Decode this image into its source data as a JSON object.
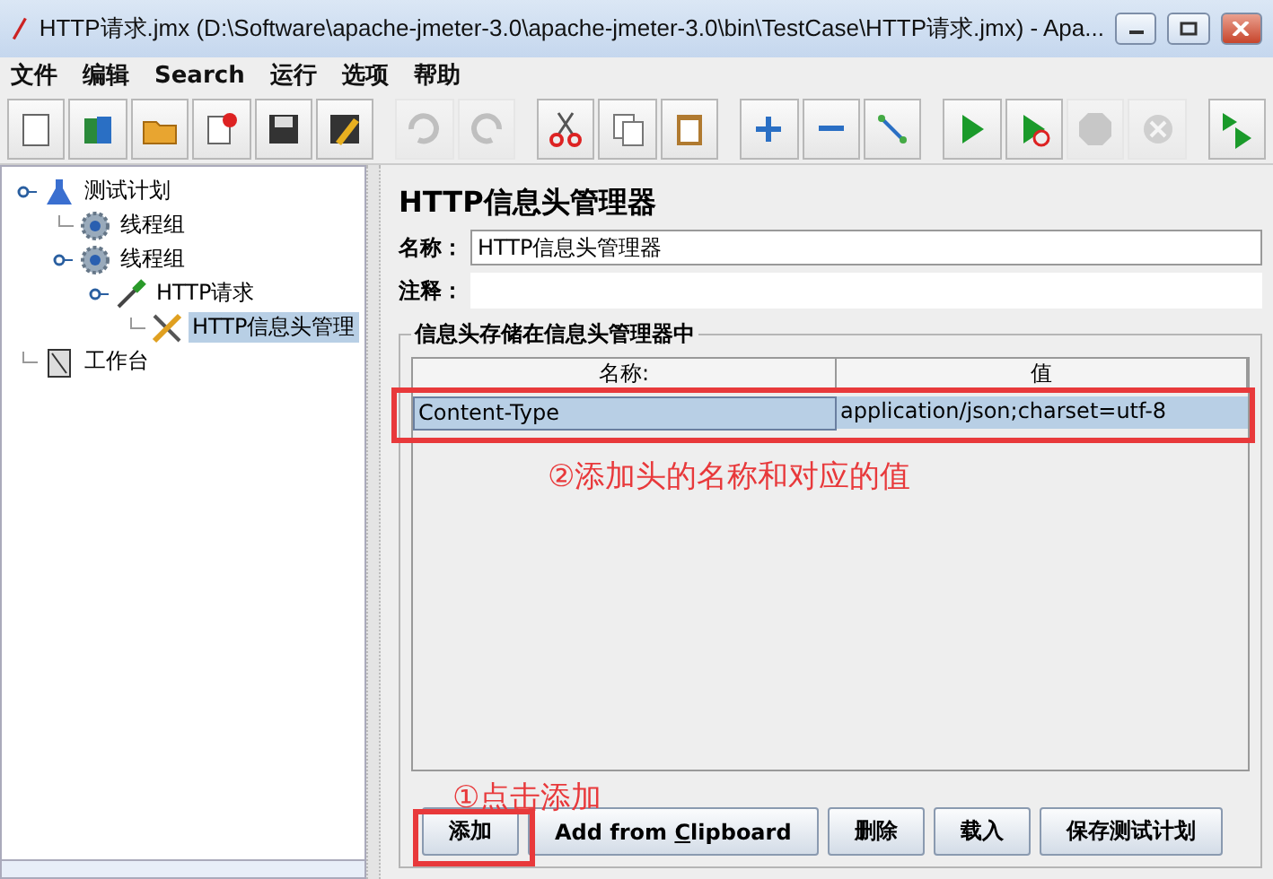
{
  "window": {
    "title": "HTTP请求.jmx (D:\\Software\\apache-jmeter-3.0\\apache-jmeter-3.0\\bin\\TestCase\\HTTP请求.jmx) - Apa..."
  },
  "menu": [
    "文件",
    "编辑",
    "Search",
    "运行",
    "选项",
    "帮助"
  ],
  "toolbar": [
    {
      "kind": "new",
      "disabled": false
    },
    {
      "kind": "templates",
      "disabled": false
    },
    {
      "kind": "open",
      "disabled": false
    },
    {
      "kind": "close",
      "disabled": false
    },
    {
      "kind": "save",
      "disabled": false
    },
    {
      "kind": "saveas",
      "disabled": false
    },
    {
      "kind": "undo",
      "disabled": true
    },
    {
      "kind": "redo",
      "disabled": true
    },
    {
      "kind": "cut",
      "disabled": false
    },
    {
      "kind": "copy",
      "disabled": false
    },
    {
      "kind": "paste",
      "disabled": false
    },
    {
      "kind": "add",
      "disabled": false
    },
    {
      "kind": "remove",
      "disabled": false
    },
    {
      "kind": "toggle",
      "disabled": false
    },
    {
      "kind": "start",
      "disabled": false
    },
    {
      "kind": "startnopause",
      "disabled": false
    },
    {
      "kind": "stop",
      "disabled": true
    },
    {
      "kind": "shutdown",
      "disabled": true
    },
    {
      "kind": "remote",
      "disabled": false
    }
  ],
  "tree": [
    {
      "label": "测试计划",
      "kind": "plan",
      "selected": false,
      "expanded": true,
      "children": [
        {
          "label": "线程组",
          "kind": "group",
          "selected": false,
          "expanded": false
        },
        {
          "label": "线程组",
          "kind": "group",
          "selected": false,
          "expanded": true,
          "children": [
            {
              "label": "HTTP请求",
              "kind": "sampler",
              "selected": false,
              "expanded": true,
              "children": [
                {
                  "label": "HTTP信息头管理",
                  "kind": "config",
                  "selected": true,
                  "expanded": false
                }
              ]
            }
          ]
        }
      ]
    },
    {
      "label": "工作台",
      "kind": "workbench",
      "selected": false,
      "expanded": false
    }
  ],
  "panel": {
    "title": "HTTP信息头管理器",
    "name_label": "名称：",
    "name_value": "HTTP信息头管理器",
    "comment_label": "注释：",
    "group_title": "信息头存储在信息头管理器中",
    "columns": [
      "名称:",
      "值"
    ],
    "rows": [
      {
        "cells": [
          "Content-Type",
          "application/json;charset=utf-8"
        ],
        "selected": true
      }
    ],
    "buttons": [
      {
        "label": "添加"
      },
      {
        "before": "Add from ",
        "mnemonic": "C",
        "after": "lipboard"
      },
      {
        "label": "删除"
      },
      {
        "label": "载入"
      },
      {
        "label": "保存测试计划"
      }
    ]
  },
  "annotations": [
    {
      "kind": "row",
      "text": "②添加头的名称和对应的值"
    },
    {
      "kind": "button",
      "text": "①点击添加"
    }
  ]
}
